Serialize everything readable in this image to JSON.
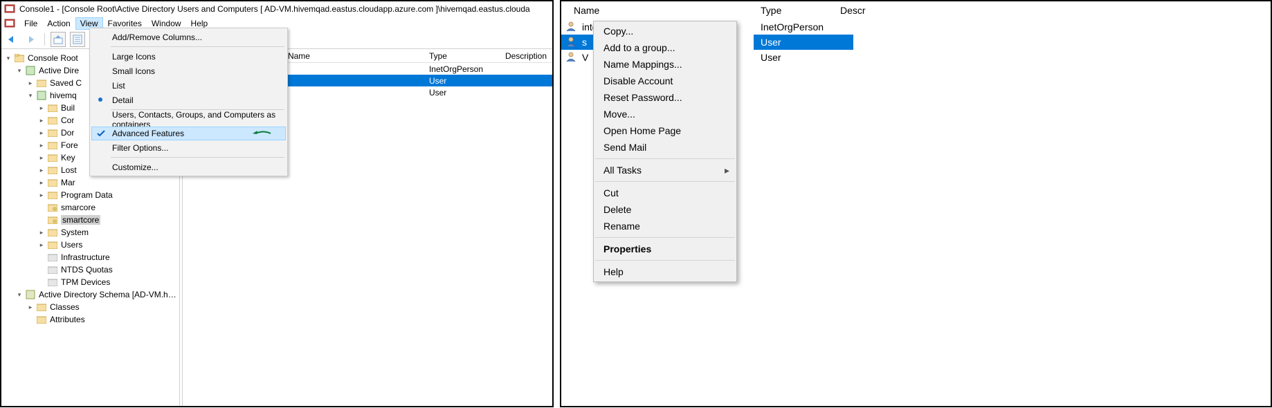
{
  "window": {
    "title": "Console1 - [Console Root\\Active Directory Users and Computers [ AD-VM.hivemqad.eastus.cloudapp.azure.com ]\\hivemqad.eastus.clouda"
  },
  "menubar": {
    "file": "File",
    "action": "Action",
    "view": "View",
    "favorites": "Favorites",
    "window": "Window",
    "help": "Help"
  },
  "view_menu": {
    "add_remove_columns": "Add/Remove Columns...",
    "large_icons": "Large Icons",
    "small_icons": "Small Icons",
    "list": "List",
    "detail": "Detail",
    "users_containers": "Users, Contacts, Groups, and Computers as containers",
    "advanced_features": "Advanced Features",
    "filter_options": "Filter Options...",
    "customize": "Customize..."
  },
  "tree": {
    "root": "Console Root",
    "aduc": "Active Dire",
    "saved": "Saved C",
    "domain": "hivemq",
    "nodes": {
      "builtin": "Buil",
      "computers": "Cor",
      "domain_controllers": "Dor",
      "foreign": "Fore",
      "keys": "Key",
      "lost": "Lost",
      "managed": "Mar",
      "program_data": "Program Data",
      "smarcore": "smarcore",
      "smartcore": "smartcore",
      "system": "System",
      "users": "Users",
      "infrastructure": "Infrastructure",
      "ntds": "NTDS Quotas",
      "tpm": "TPM Devices"
    },
    "schema": "Active Directory Schema [AD-VM.hivemqad.ea",
    "classes": "Classes",
    "attributes": "Attributes"
  },
  "left_list": {
    "columns": {
      "name": "Name",
      "type": "Type",
      "description": "Description"
    },
    "rows": [
      {
        "name": "",
        "type": "InetOrgPerson",
        "selected": false
      },
      {
        "name": "",
        "type": "User",
        "selected": true
      },
      {
        "name": "",
        "type": "User",
        "selected": false
      }
    ]
  },
  "right_list": {
    "columns": {
      "name": "Name",
      "type": "Type",
      "description": "Descr"
    },
    "rows": [
      {
        "name": "intorg",
        "type": "InetOrgPerson",
        "selected": false
      },
      {
        "name": "s",
        "type": "User",
        "selected": true
      },
      {
        "name": "V",
        "type": "User",
        "selected": false
      }
    ]
  },
  "context_menu": {
    "copy": "Copy...",
    "add_to_group": "Add to a group...",
    "name_mappings": "Name Mappings...",
    "disable_account": "Disable Account",
    "reset_password": "Reset Password...",
    "move": "Move...",
    "open_home_page": "Open Home Page",
    "send_mail": "Send Mail",
    "all_tasks": "All Tasks",
    "cut": "Cut",
    "delete": "Delete",
    "rename": "Rename",
    "properties": "Properties",
    "help": "Help"
  }
}
